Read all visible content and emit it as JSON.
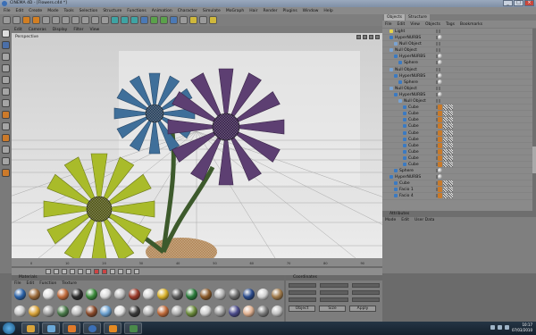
{
  "window": {
    "title": "CINEMA 4D - [Flowers.c4d *]",
    "buttons": [
      "_",
      "□",
      "×"
    ]
  },
  "menu": [
    "File",
    "Edit",
    "Create",
    "Mode",
    "Tools",
    "Selection",
    "Structure",
    "Functions",
    "Animation",
    "Character",
    "Simulate",
    "MoGraph",
    "Hair",
    "Render",
    "Plugins",
    "Window",
    "Help"
  ],
  "viewport": {
    "menu": [
      "Edit",
      "Cameras",
      "Display",
      "Filter",
      "View"
    ],
    "label": "Perspective"
  },
  "right_panel": {
    "tabs": [
      "Objects",
      "Structure"
    ],
    "menu": [
      "File",
      "Edit",
      "View",
      "Objects",
      "Tags",
      "Bookmarks"
    ],
    "objects": [
      {
        "name": "Light",
        "indent": 1,
        "icon": "light"
      },
      {
        "name": "HyperNURBS",
        "indent": 1,
        "icon": "nurbs"
      },
      {
        "name": "Null Object",
        "indent": 2,
        "icon": "null"
      },
      {
        "name": "Null Object",
        "indent": 1,
        "icon": "null"
      },
      {
        "name": "HyperNURBS",
        "indent": 2,
        "icon": "nurbs"
      },
      {
        "name": "Sphere",
        "indent": 3,
        "icon": "sphere"
      },
      {
        "name": "Null Object",
        "indent": 1,
        "icon": "null"
      },
      {
        "name": "HyperNURBS",
        "indent": 2,
        "icon": "nurbs"
      },
      {
        "name": "Sphere",
        "indent": 3,
        "icon": "sphere"
      },
      {
        "name": "Null Object",
        "indent": 1,
        "icon": "null"
      },
      {
        "name": "HyperNURBS",
        "indent": 2,
        "icon": "nurbs"
      },
      {
        "name": "Null Object",
        "indent": 3,
        "icon": "null"
      },
      {
        "name": "Cube",
        "indent": 4,
        "icon": "cube"
      },
      {
        "name": "Cube",
        "indent": 4,
        "icon": "cube"
      },
      {
        "name": "Cube",
        "indent": 4,
        "icon": "cube"
      },
      {
        "name": "Cube",
        "indent": 4,
        "icon": "cube"
      },
      {
        "name": "Cube",
        "indent": 4,
        "icon": "cube"
      },
      {
        "name": "Cube",
        "indent": 4,
        "icon": "cube"
      },
      {
        "name": "Cube",
        "indent": 4,
        "icon": "cube"
      },
      {
        "name": "Cube",
        "indent": 4,
        "icon": "cube"
      },
      {
        "name": "Cube",
        "indent": 4,
        "icon": "cube"
      },
      {
        "name": "Cube",
        "indent": 4,
        "icon": "cube"
      },
      {
        "name": "Sphere",
        "indent": 2,
        "icon": "sphere"
      },
      {
        "name": "HyperNURBS",
        "indent": 1,
        "icon": "nurbs"
      },
      {
        "name": "Cube",
        "indent": 2,
        "icon": "cube"
      },
      {
        "name": "Facio 1",
        "indent": 2,
        "icon": "cube"
      },
      {
        "name": "Facio 4",
        "indent": 2,
        "icon": "cube"
      }
    ],
    "attributes": {
      "title": "Attributes",
      "menu": [
        "Mode",
        "Edit",
        "User Data"
      ]
    }
  },
  "timeline": {
    "ticks": [
      "0",
      "10",
      "20",
      "30",
      "40",
      "50",
      "60",
      "70",
      "80",
      "90"
    ]
  },
  "materials": {
    "title": "Materials",
    "menu": [
      "File",
      "Edit",
      "Function",
      "Texture"
    ]
  },
  "coordinates": {
    "title": "Coordinates",
    "buttons": [
      "Object",
      "Size",
      "Apply"
    ]
  },
  "taskbar": {
    "time": "10:17",
    "date": "07/03/2010"
  },
  "colors": {
    "accent": "#d17e22",
    "flower_blue": "#3f6f9a",
    "flower_purple": "#5d3f72",
    "flower_yellow": "#a9bb2a",
    "stem": "#3d5a2c"
  }
}
